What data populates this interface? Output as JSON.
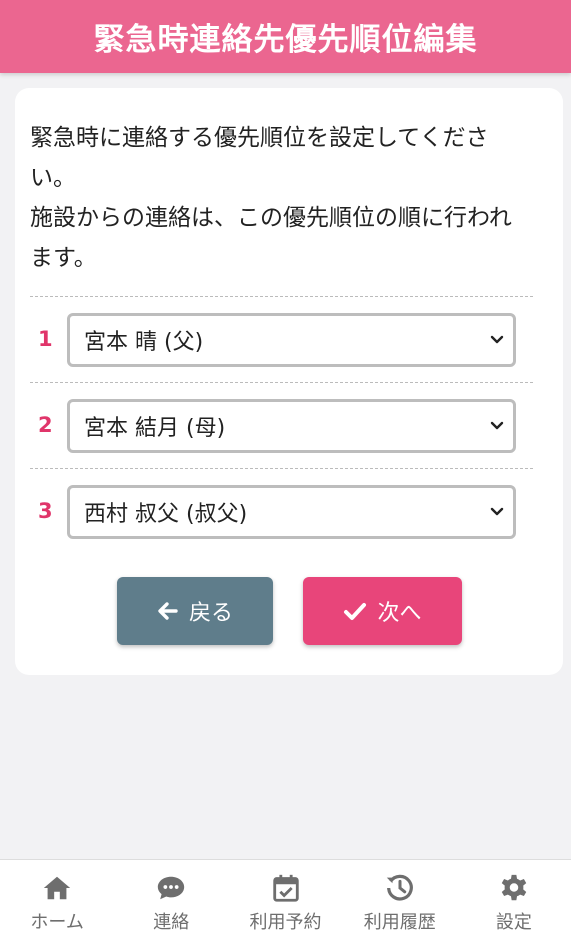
{
  "header": {
    "title": "緊急時連絡先優先順位編集"
  },
  "description": {
    "line1": "緊急時に連絡する優先順位を設定してくださ",
    "line2": "い。",
    "line3": "施設からの連絡は、この優先順位の順に行われ",
    "line4": "ます。"
  },
  "priorities": [
    {
      "number": "1",
      "selected": "宮本 晴 (父)"
    },
    {
      "number": "2",
      "selected": "宮本 結月 (母)"
    },
    {
      "number": "3",
      "selected": "西村 叔父 (叔父)"
    }
  ],
  "buttons": {
    "back": "戻る",
    "next": "次へ"
  },
  "colors": {
    "header": "#eb6690",
    "accent": "#e8457a",
    "back": "#5f7d8b",
    "number": "#e0356a"
  },
  "nav": [
    {
      "label": "ホーム",
      "icon": "home-icon"
    },
    {
      "label": "連絡",
      "icon": "chat-icon"
    },
    {
      "label": "利用予約",
      "icon": "calendar-check-icon"
    },
    {
      "label": "利用履歴",
      "icon": "history-icon"
    },
    {
      "label": "設定",
      "icon": "gear-icon"
    }
  ]
}
